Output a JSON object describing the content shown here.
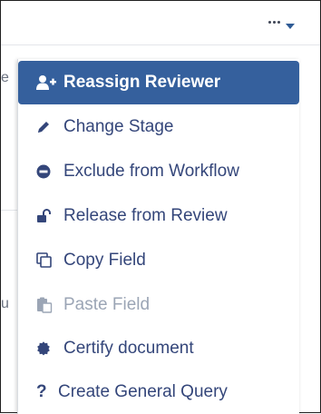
{
  "menu": {
    "items": [
      {
        "label": "Reassign Reviewer",
        "icon": "user-plus-icon",
        "state": "active"
      },
      {
        "label": "Change Stage",
        "icon": "pencil-icon",
        "state": "enabled"
      },
      {
        "label": "Exclude from Workflow",
        "icon": "minus-circle-icon",
        "state": "enabled"
      },
      {
        "label": "Release from Review",
        "icon": "unlock-icon",
        "state": "enabled"
      },
      {
        "label": "Copy Field",
        "icon": "copy-icon",
        "state": "enabled"
      },
      {
        "label": "Paste Field",
        "icon": "paste-icon",
        "state": "disabled"
      },
      {
        "label": "Certify document",
        "icon": "certificate-icon",
        "state": "enabled"
      },
      {
        "label": "Create General Query",
        "icon": "question-icon",
        "state": "enabled"
      }
    ]
  },
  "colors": {
    "accent": "#35609d",
    "text": "#34467a",
    "disabled": "#9ba5b5"
  }
}
